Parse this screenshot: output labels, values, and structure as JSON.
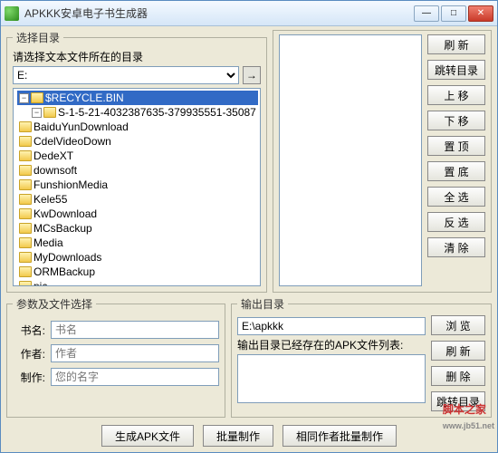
{
  "window": {
    "title": "APKKK安卓电子书生成器"
  },
  "dir_group": {
    "legend": "选择目录",
    "prompt": "请选择文本文件所在的目录",
    "drive": "E:",
    "tree": {
      "root": "$RECYCLE.BIN",
      "children_lvl2": [
        "S-1-5-21-4032387635-379935551-35087"
      ],
      "siblings": [
        "BaiduYunDownload",
        "CdelVideoDown",
        "DedeXT",
        "downsoft",
        "FunshionMedia",
        "Kele55",
        "KwDownload",
        "MCsBackup",
        "Media",
        "MyDownloads",
        "ORMBackup",
        "pic"
      ]
    }
  },
  "side_buttons": [
    "刷 新",
    "跳转目录",
    "上 移",
    "下 移",
    "置 顶",
    "置 底",
    "全 选",
    "反 选",
    "清 除"
  ],
  "params": {
    "legend": "参数及文件选择",
    "bookname_label": "书名:",
    "bookname_ph": "书名",
    "author_label": "作者:",
    "author_ph": "作者",
    "maker_label": "制作:",
    "maker_ph": "您的名字"
  },
  "output": {
    "legend": "输出目录",
    "path": "E:\\apkkk",
    "list_label": "输出目录已经存在的APK文件列表:",
    "browse": "浏 览",
    "refresh": "刷 新",
    "delete": "删 除",
    "jump": "跳转目录"
  },
  "actions": [
    "生成APK文件",
    "批量制作",
    "相同作者批量制作"
  ],
  "watermark": "脚本之家",
  "watermark_sub": "www.jb51.net"
}
